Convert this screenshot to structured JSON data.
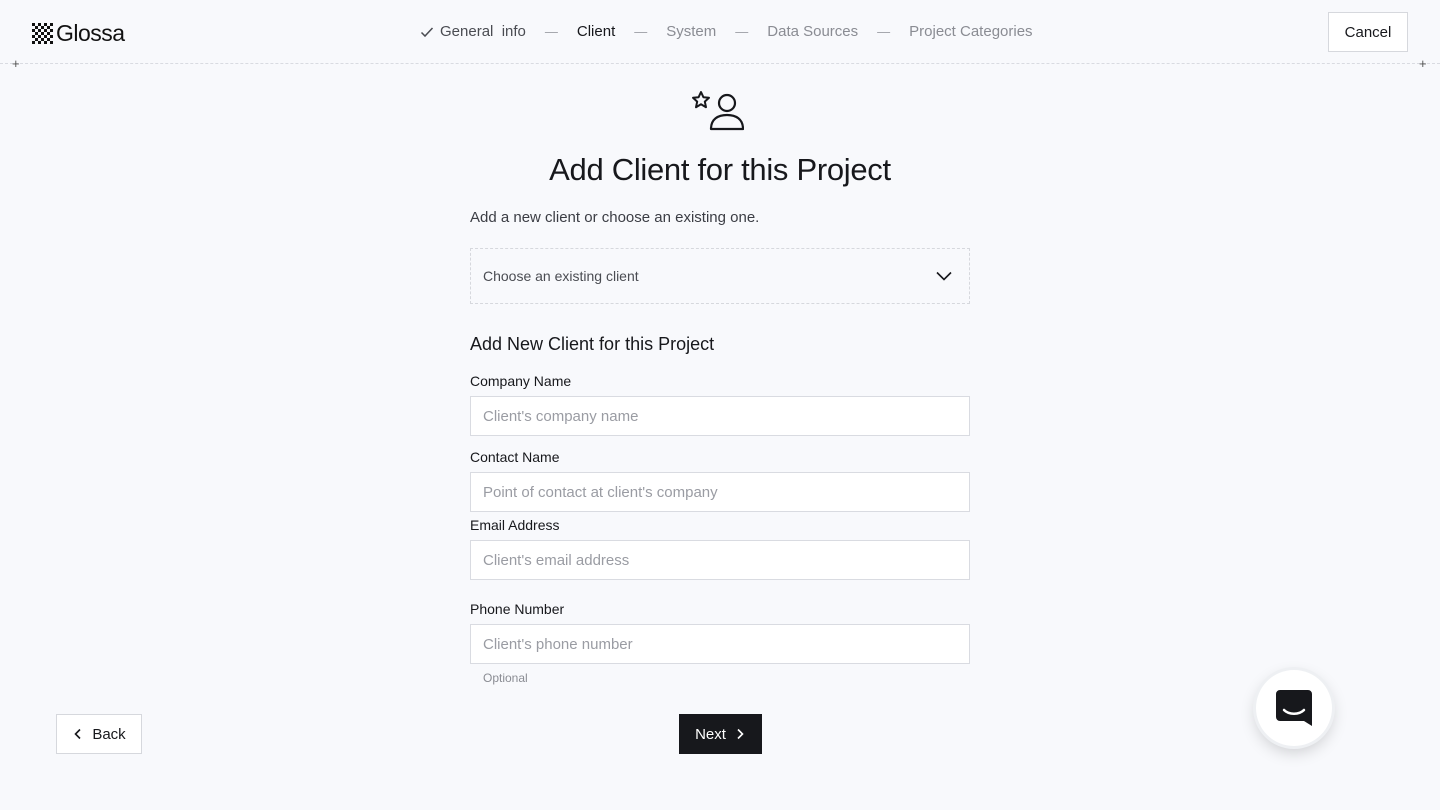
{
  "app": {
    "name": "Glossa"
  },
  "header": {
    "steps": [
      {
        "label": "General  info",
        "state": "done"
      },
      {
        "label": "Client",
        "state": "active"
      },
      {
        "label": "System",
        "state": "upcoming"
      },
      {
        "label": "Data Sources",
        "state": "upcoming"
      },
      {
        "label": "Project Categories",
        "state": "upcoming"
      }
    ],
    "separator": "—",
    "cancel_label": "Cancel"
  },
  "main": {
    "icon": "user-star-icon",
    "title": "Add Client for this Project",
    "subtitle": "Add a new client or choose an existing one.",
    "existing_client_select": {
      "placeholder": "Choose an existing client"
    },
    "section_title": "Add New Client for this Project",
    "fields": {
      "company_name": {
        "label": "Company Name",
        "placeholder": "Client's company name",
        "value": ""
      },
      "contact_name": {
        "label": "Contact Name",
        "placeholder": "Point of contact at client's company",
        "value": ""
      },
      "email": {
        "label": "Email Address",
        "placeholder": "Client's email address",
        "value": ""
      },
      "phone": {
        "label": "Phone Number",
        "placeholder": "Client's phone number",
        "value": "",
        "helper": "Optional"
      }
    }
  },
  "footer": {
    "back_label": "Back",
    "next_label": "Next"
  },
  "chat_widget": {
    "icon": "chat-icon"
  },
  "colors": {
    "background": "#f8f9fc",
    "primary_button": "#17181c",
    "border": "#d9dbe1",
    "muted_text": "#8a8c93"
  }
}
